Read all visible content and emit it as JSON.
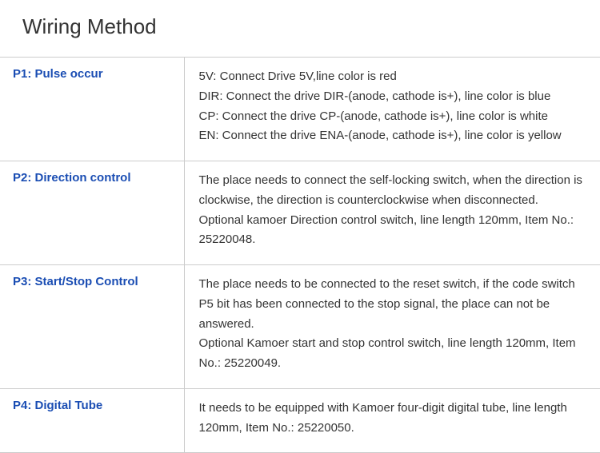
{
  "heading": "Wiring Method",
  "rows": [
    {
      "label": "P1: Pulse occur",
      "lines": [
        "5V: Connect Drive 5V,line color is red",
        "DIR: Connect the drive DIR-(anode, cathode is+), line color is blue",
        "CP: Connect the drive CP-(anode, cathode is+), line color is white",
        "EN: Connect the drive ENA-(anode, cathode is+), line color is yellow"
      ]
    },
    {
      "label": "P2: Direction control",
      "lines": [
        "The place needs to connect the self-locking switch, when the direction is clockwise, the direction is counterclockwise when disconnected.",
        "Optional kamoer Direction control switch, line length 120mm, Item No.: 25220048."
      ]
    },
    {
      "label": "P3: Start/Stop Control",
      "lines": [
        "The place needs to be connected to the reset switch, if the code switch P5 bit has been connected to the stop signal, the place can not be answered.",
        "Optional Kamoer start and stop control switch, line length 120mm, Item No.: 25220049."
      ]
    },
    {
      "label": "P4: Digital Tube",
      "lines": [
        "It needs to be equipped with Kamoer four-digit digital tube, line length 120mm, Item No.: 25220050."
      ]
    }
  ]
}
